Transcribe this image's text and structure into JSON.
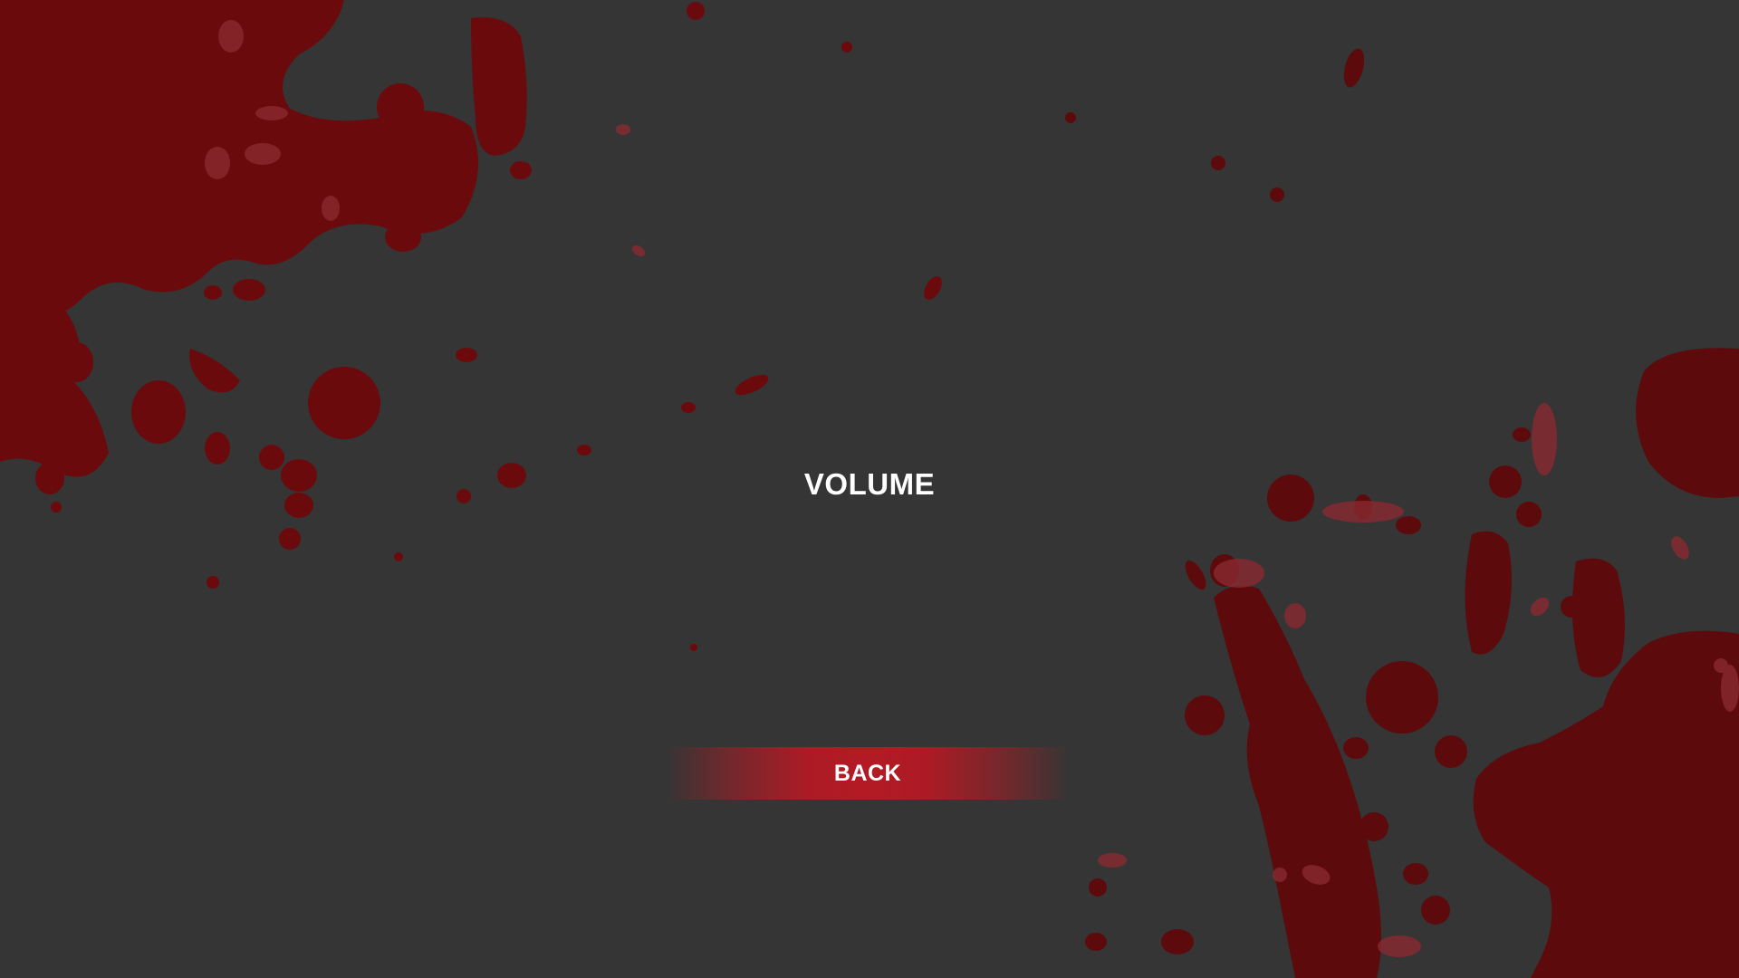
{
  "screen": {
    "name": "volume-settings",
    "background_color": "#353535",
    "splatter_color": "#6e0b0c",
    "accent_color": "#b21a24"
  },
  "menu": {
    "heading": "VOLUME",
    "back_label": "BACK"
  }
}
